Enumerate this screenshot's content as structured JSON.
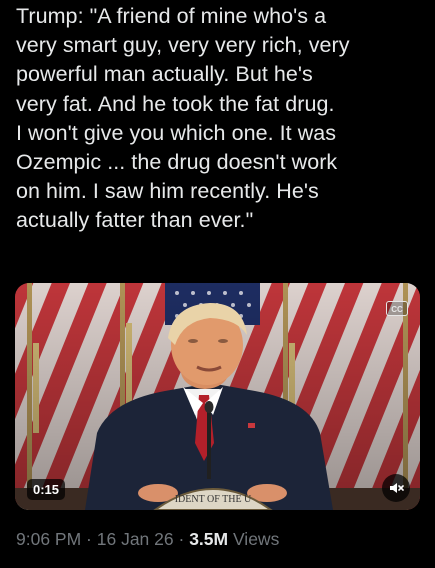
{
  "tweet": {
    "text_lines": [
      "Trump: \"A friend of mine who's a",
      "very smart guy, very very rich, very",
      "powerful man actually. But he's",
      "very fat. And he took the fat drug.",
      "I won't give you which one. It was",
      "Ozempic ... the drug doesn't work",
      "on him. I saw him recently. He's",
      "actually fatter than ever.\""
    ]
  },
  "video": {
    "duration": "0:15",
    "cc_label": "CC",
    "seal_text": "IDENT OF THE U",
    "icons": [
      "closed-captions-icon",
      "muted-speaker-icon"
    ]
  },
  "meta": {
    "time": "9:06 PM",
    "separator1": " · ",
    "date": "16 Jan 26",
    "separator2": " · ",
    "views_count": "3.5M",
    "views_label": " Views"
  },
  "colors": {
    "background": "#000000",
    "text": "#e7e9ea",
    "secondary": "#71767b"
  }
}
